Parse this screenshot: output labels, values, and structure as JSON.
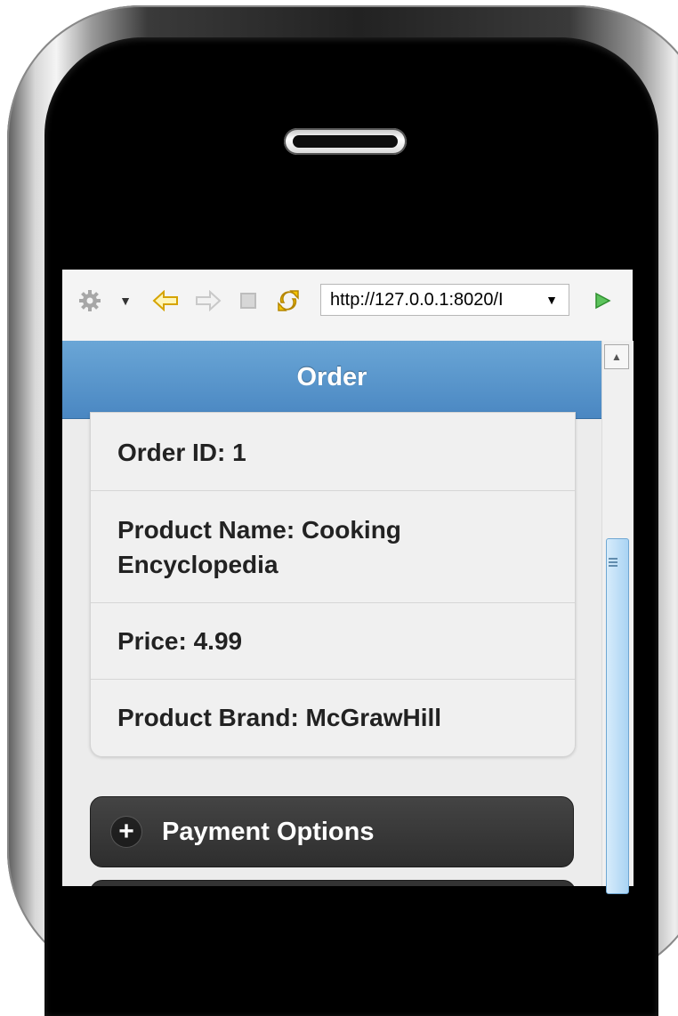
{
  "browser": {
    "url": "http://127.0.0.1:8020/I",
    "icons": [
      "gear-icon",
      "back-arrow-icon",
      "forward-arrow-icon",
      "stop-icon",
      "refresh-icon",
      "go-icon"
    ]
  },
  "header": {
    "title": "Order"
  },
  "order_details": [
    {
      "text": "Order ID: 1"
    },
    {
      "text": "Product Name: Cooking Encyclopedia"
    },
    {
      "text": "Price: 4.99"
    },
    {
      "text": "Product Brand: McGrawHill"
    }
  ],
  "collapsible": {
    "label": "Payment Options"
  },
  "colors": {
    "header": "#4a87c2",
    "collapsible": "#333333",
    "go": "#3aa93a"
  }
}
